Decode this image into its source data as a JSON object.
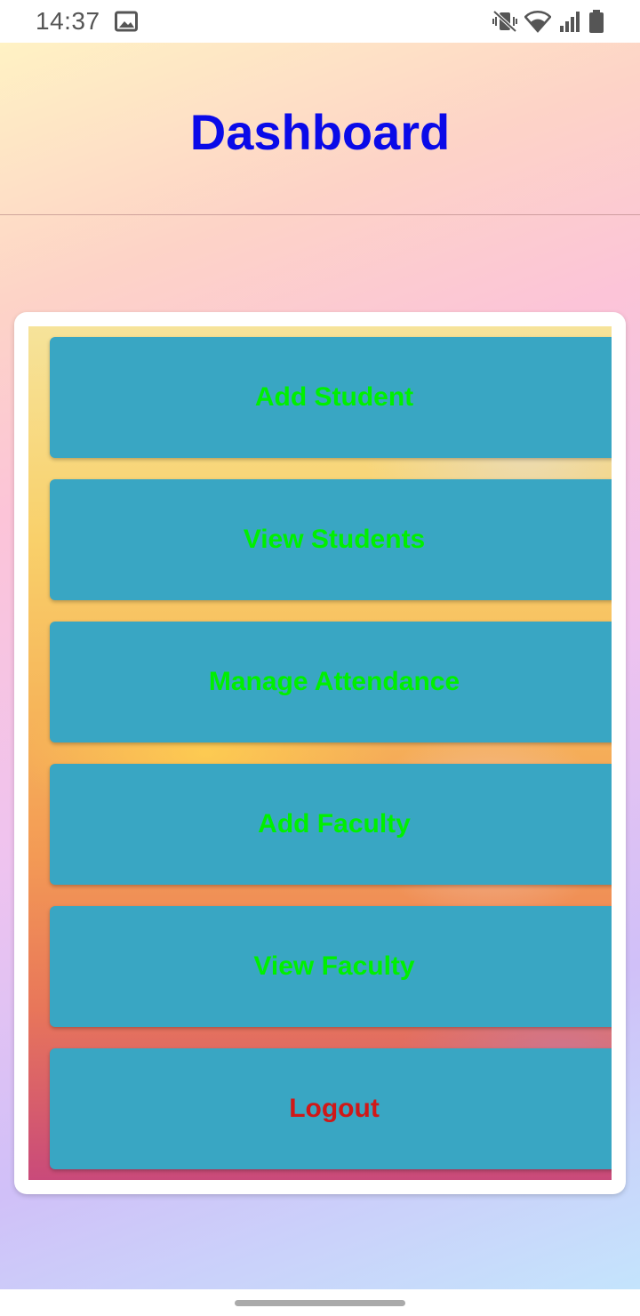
{
  "status_bar": {
    "time": "14:37",
    "icons": [
      "image-icon",
      "mute-vibrate-icon",
      "wifi-icon",
      "signal-icon",
      "battery-icon"
    ]
  },
  "header": {
    "title": "Dashboard"
  },
  "menu": {
    "items": [
      {
        "label": "Add Student"
      },
      {
        "label": "View Students"
      },
      {
        "label": "Manage Attendance"
      },
      {
        "label": "Add Faculty"
      },
      {
        "label": "View Faculty"
      },
      {
        "label": "Logout"
      }
    ]
  },
  "colors": {
    "title": "#0a0ae8",
    "button_bg": "#39a6c3",
    "button_text": "#00f000",
    "logout_text": "#d01818"
  }
}
